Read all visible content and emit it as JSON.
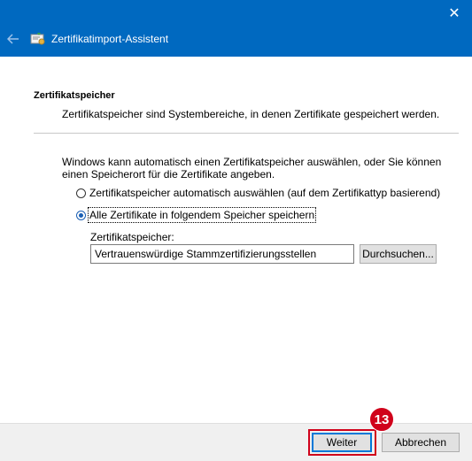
{
  "window": {
    "title": "Zertifikatimport-Assistent",
    "close_glyph": "✕",
    "back_icon": "back-arrow-icon",
    "app_icon": "certificate-icon"
  },
  "page": {
    "section_title": "Zertifikatspeicher",
    "section_desc": "Zertifikatspeicher sind Systembereiche, in denen Zertifikate gespeichert werden.",
    "intro": "Windows kann automatisch einen Zertifikatspeicher auswählen, oder Sie können einen Speicherort für die Zertifikate angeben.",
    "options": [
      {
        "label": "Zertifikatspeicher automatisch auswählen (auf dem Zertifikattyp basierend)",
        "selected": false
      },
      {
        "label": "Alle Zertifikate in folgendem Speicher speichern",
        "selected": true
      }
    ],
    "store_label": "Zertifikatspeicher:",
    "store_value": "Vertrauenswürdige Stammzertifizierungsstellen",
    "browse_label": "Durchsuchen..."
  },
  "footer": {
    "next_label": "Weiter",
    "cancel_label": "Abbrechen"
  },
  "annotation": {
    "step_number": "13",
    "color": "#d0021b"
  }
}
